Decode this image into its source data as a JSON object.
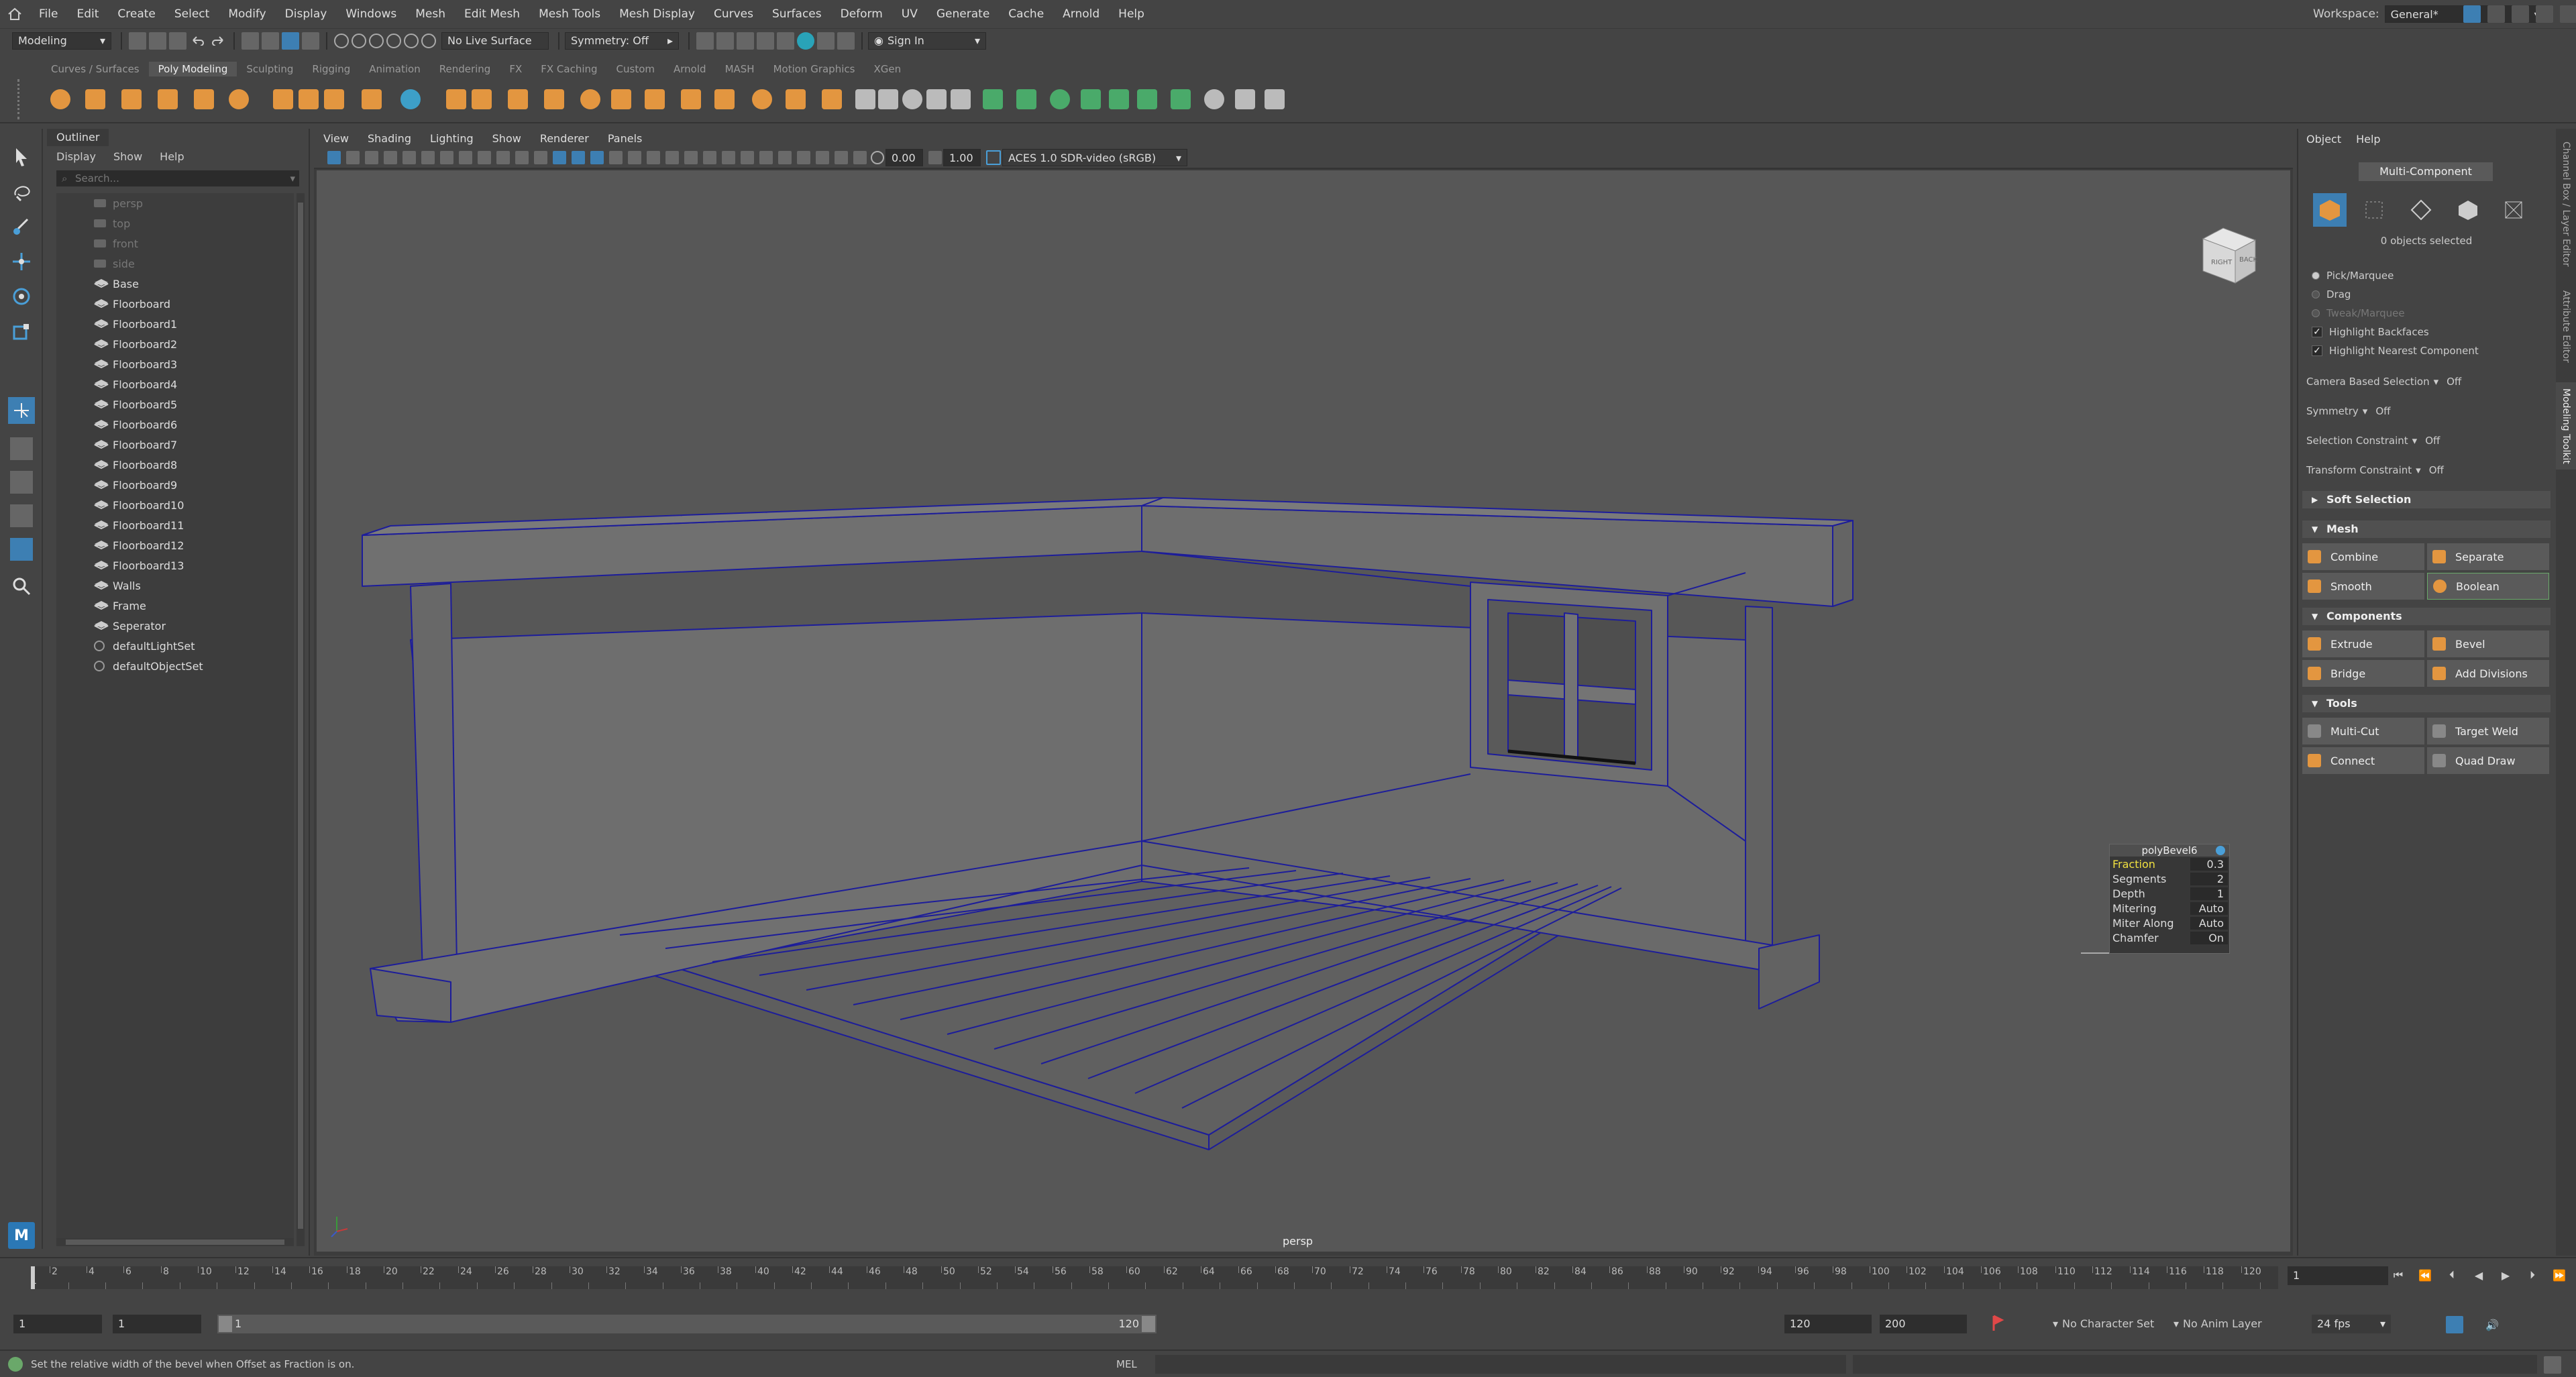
{
  "menubar": {
    "items": [
      "File",
      "Edit",
      "Create",
      "Select",
      "Modify",
      "Display",
      "Windows",
      "Mesh",
      "Edit Mesh",
      "Mesh Tools",
      "Mesh Display",
      "Curves",
      "Surfaces",
      "Deform",
      "UV",
      "Generate",
      "Cache",
      "Arnold",
      "Help"
    ],
    "workspace_label": "Workspace:",
    "workspace_value": "General*"
  },
  "statusline": {
    "menuset": "Modeling",
    "live_surface": "No Live Surface",
    "symmetry": "Symmetry: Off",
    "sign_in": "Sign In"
  },
  "shelf": {
    "tabs": [
      "Curves / Surfaces",
      "Poly Modeling",
      "Sculpting",
      "Rigging",
      "Animation",
      "Rendering",
      "FX",
      "FX Caching",
      "Custom",
      "Arnold",
      "MASH",
      "Motion Graphics",
      "XGen"
    ],
    "active_tab": "Poly Modeling",
    "accent": "#e39640"
  },
  "outliner": {
    "title": "Outliner",
    "menu": [
      "Display",
      "Show",
      "Help"
    ],
    "search_placeholder": "Search...",
    "items": [
      {
        "label": "persp",
        "kind": "camera"
      },
      {
        "label": "top",
        "kind": "camera"
      },
      {
        "label": "front",
        "kind": "camera"
      },
      {
        "label": "side",
        "kind": "camera"
      },
      {
        "label": "Base",
        "kind": "mesh"
      },
      {
        "label": "Floorboard",
        "kind": "mesh"
      },
      {
        "label": "Floorboard1",
        "kind": "mesh"
      },
      {
        "label": "Floorboard2",
        "kind": "mesh"
      },
      {
        "label": "Floorboard3",
        "kind": "mesh"
      },
      {
        "label": "Floorboard4",
        "kind": "mesh"
      },
      {
        "label": "Floorboard5",
        "kind": "mesh"
      },
      {
        "label": "Floorboard6",
        "kind": "mesh"
      },
      {
        "label": "Floorboard7",
        "kind": "mesh"
      },
      {
        "label": "Floorboard8",
        "kind": "mesh"
      },
      {
        "label": "Floorboard9",
        "kind": "mesh"
      },
      {
        "label": "Floorboard10",
        "kind": "mesh"
      },
      {
        "label": "Floorboard11",
        "kind": "mesh"
      },
      {
        "label": "Floorboard12",
        "kind": "mesh"
      },
      {
        "label": "Floorboard13",
        "kind": "mesh"
      },
      {
        "label": "Walls",
        "kind": "mesh"
      },
      {
        "label": "Frame",
        "kind": "mesh"
      },
      {
        "label": "Seperator",
        "kind": "mesh"
      },
      {
        "label": "defaultLightSet",
        "kind": "set"
      },
      {
        "label": "defaultObjectSet",
        "kind": "set"
      }
    ]
  },
  "viewport": {
    "menu": [
      "View",
      "Shading",
      "Lighting",
      "Show",
      "Renderer",
      "Panels"
    ],
    "near_value": "0.00",
    "far_value": "1.00",
    "color_space": "ACES 1.0 SDR-video (sRGB)",
    "camera_label": "persp",
    "viewcube_right": "RIGHT",
    "viewcube_back": "BACK"
  },
  "bevel_hud": {
    "title": "polyBevel6",
    "rows": [
      {
        "key": "Fraction",
        "value": "0.3"
      },
      {
        "key": "Segments",
        "value": "2"
      },
      {
        "key": "Depth",
        "value": "1"
      },
      {
        "key": "Mitering",
        "value": "Auto"
      },
      {
        "key": "Miter Along",
        "value": "Auto"
      },
      {
        "key": "Chamfer",
        "value": "On"
      }
    ]
  },
  "modeling_toolkit": {
    "menu": [
      "Object",
      "Help"
    ],
    "mode": "Multi-Component",
    "objects_selected": "0 objects selected",
    "pick_marquee": "Pick/Marquee",
    "drag": "Drag",
    "tweak_marquee": "Tweak/Marquee",
    "highlight_backfaces": "Highlight Backfaces",
    "highlight_nearest": "Highlight Nearest Component",
    "camera_based": {
      "label": "Camera Based Selection",
      "value": "Off"
    },
    "symmetry": {
      "label": "Symmetry",
      "value": "Off"
    },
    "selection_constraint": {
      "label": "Selection Constraint",
      "value": "Off"
    },
    "transform_constraint": {
      "label": "Transform Constraint",
      "value": "Off"
    },
    "soft_selection": "Soft Selection",
    "mesh_section": "Mesh",
    "combine": "Combine",
    "separate": "Separate",
    "smooth": "Smooth",
    "boolean": "Boolean",
    "components_section": "Components",
    "extrude": "Extrude",
    "bevel": "Bevel",
    "bridge": "Bridge",
    "add_divisions": "Add Divisions",
    "tools_section": "Tools",
    "multi_cut": "Multi-Cut",
    "target_weld": "Target Weld",
    "connect": "Connect",
    "quad_draw": "Quad Draw"
  },
  "side_tabs": [
    "Channel Box / Layer Editor",
    "Attribute Editor",
    "Modeling Toolkit"
  ],
  "timeline": {
    "ticks": [
      "2",
      "4",
      "6",
      "8",
      "10",
      "12",
      "14",
      "16",
      "18",
      "20",
      "22",
      "24",
      "26",
      "28",
      "30",
      "32",
      "34",
      "36",
      "38",
      "40",
      "42",
      "44",
      "46",
      "48",
      "50",
      "52",
      "54",
      "56",
      "58",
      "60",
      "62",
      "64",
      "66",
      "68",
      "70",
      "72",
      "74",
      "76",
      "78",
      "80",
      "82",
      "84",
      "86",
      "88",
      "90",
      "92",
      "94",
      "96",
      "98",
      "100",
      "102",
      "104",
      "106",
      "108",
      "110",
      "112",
      "114",
      "116",
      "118",
      "120"
    ],
    "first_tick": "1",
    "current_frame": "1"
  },
  "range": {
    "start": "1",
    "playback_start": "1",
    "slider_start": "1",
    "slider_end": "120",
    "playback_end": "120",
    "end": "200",
    "character_set": "No Character Set",
    "anim_layer": "No Anim Layer",
    "fps": "24 fps"
  },
  "helpline": {
    "message": "Set the relative width of the bevel when Offset as Fraction is on.",
    "mel_label": "MEL"
  }
}
